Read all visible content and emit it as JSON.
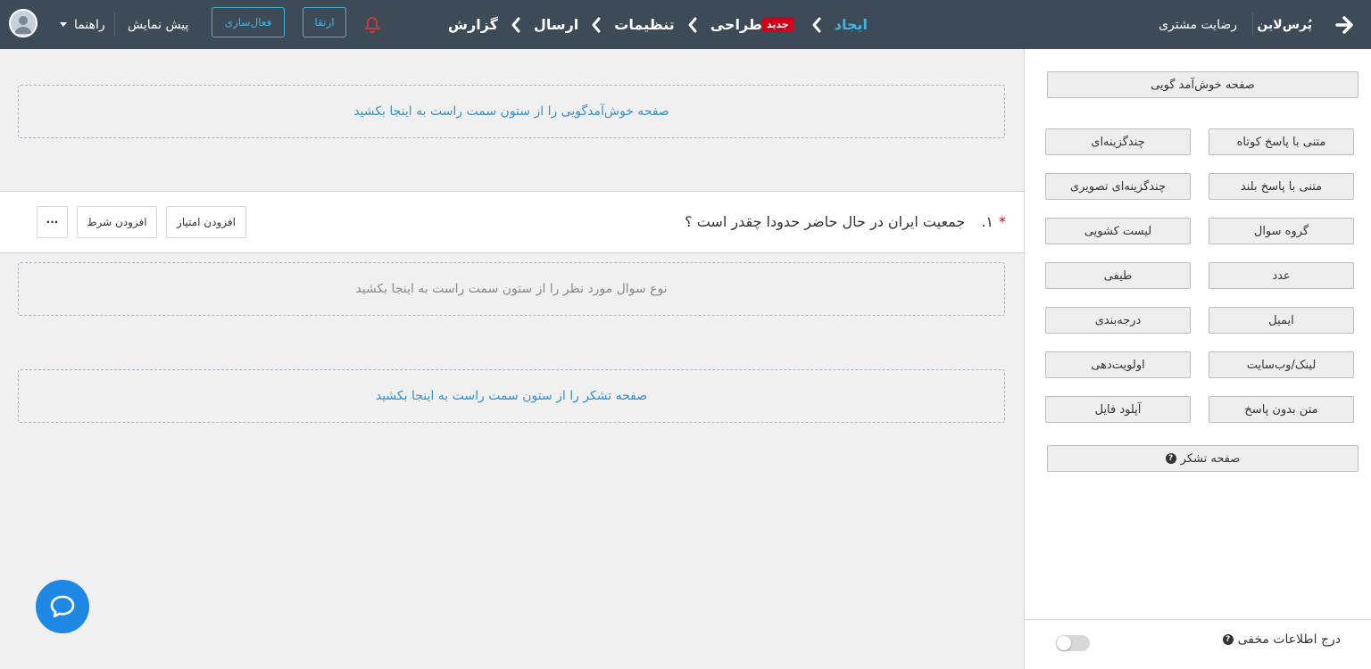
{
  "header": {
    "brand": "پُرس‌لاین",
    "survey_name": "رضایت مشتری",
    "steps": [
      {
        "label": "ایجاد",
        "active": true
      },
      {
        "label": "طراحی",
        "badge": "جدید"
      },
      {
        "label": "تنظیمات"
      },
      {
        "label": "ارسال"
      },
      {
        "label": "گزارش"
      }
    ],
    "upgrade_label": "ارتقا",
    "activate_label": "فعال‌سازی",
    "preview_label": "پیش نمایش",
    "help_label": "راهنما"
  },
  "main": {
    "welcome_drop": "صفحه خوش‌آمدگویی را از ستون سمت راست به اینجا بکشید",
    "question": {
      "required_mark": "*",
      "number": "۱.",
      "text": "جمعیت ایران در حال حاضر حدودا چقدر است ؟",
      "add_score": "افزودن امتیاز",
      "add_condition": "افزودن شرط",
      "more": "···"
    },
    "type_drop": "نوع سوال مورد نظر را از ستون سمت راست به اینجا بکشید",
    "thanks_drop": "صفحه تشکر را از ستون سمت راست به اینجا بکشید"
  },
  "sidebar": {
    "welcome_page": "صفحه خوش‌آمد گویی",
    "question_types": [
      [
        "متنی با پاسخ کوتاه",
        "چندگزینه‌ای"
      ],
      [
        "متنی با پاسخ بلند",
        "چندگزینه‌ای تصویری"
      ],
      [
        "گروه سوال",
        "لیست کشویی"
      ],
      [
        "عدد",
        "طیفی"
      ],
      [
        "ایمیل",
        "درجه‌بندی"
      ],
      [
        "لینک/وب‌سایت",
        "اولویت‌دهی"
      ],
      [
        "متن بدون پاسخ",
        "آپلود فایل"
      ]
    ],
    "thanks_page": "صفحه تشکر",
    "hidden_info_label": "درج اطلاعات مخفی",
    "hidden_info_enabled": false
  },
  "colors": {
    "topbar": "#3d4a57",
    "accent": "#45b3dc",
    "badge": "#d0021b",
    "chat": "#1e88e5"
  }
}
